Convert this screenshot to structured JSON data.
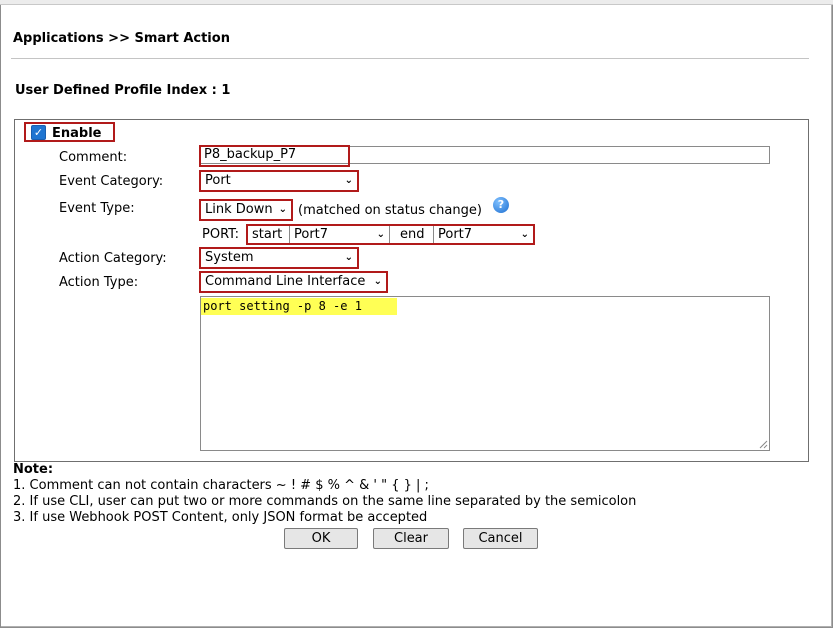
{
  "breadcrumb": "Applications >> Smart Action",
  "profile_title": "User Defined Profile Index : 1",
  "enable": {
    "label": "Enable",
    "checked": true
  },
  "form": {
    "comment_label": "Comment:",
    "comment_value": "P8_backup_P7",
    "event_category_label": "Event Category:",
    "event_category_value": "Port",
    "event_type_label": "Event Type:",
    "event_type_value": "Link Down",
    "event_type_note": "(matched on status change)",
    "port_label": "PORT:",
    "port_start_label": "start",
    "port_start_value": "Port7",
    "port_end_label": "end",
    "port_end_value": "Port7",
    "action_category_label": "Action Category:",
    "action_category_value": "System",
    "action_type_label": "Action Type:",
    "action_type_value": "Command Line Interface",
    "cli_content": "port setting -p 8 -e 1"
  },
  "notes": {
    "title": "Note:",
    "items": [
      "1. Comment can not contain characters ~ ! # $ % ^ & ' \" { } | ;",
      "2. If use CLI, user can put two or more commands on the same line separated by the semicolon",
      "3. If use Webhook POST Content, only JSON format be accepted"
    ]
  },
  "buttons": {
    "ok": "OK",
    "clear": "Clear",
    "cancel": "Cancel"
  },
  "icons": {
    "help": "help-icon",
    "dropdown": "chevron-down-icon",
    "checkbox": "check-icon"
  },
  "colors": {
    "highlight_border": "#b11a1a",
    "cli_highlight": "#ffff55",
    "checkbox": "#1f75d1"
  }
}
